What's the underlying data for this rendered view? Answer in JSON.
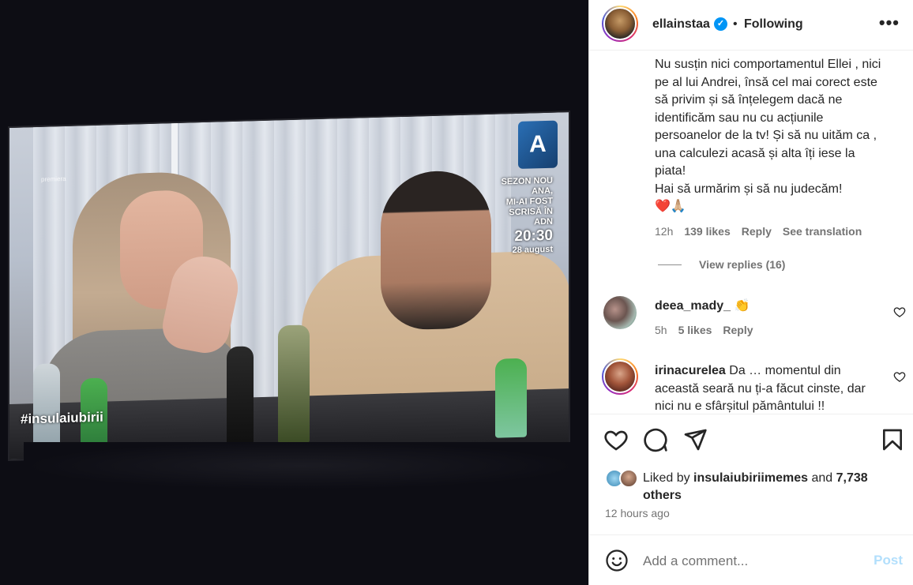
{
  "media": {
    "tv_logo": "A",
    "promo": [
      "SEZON NOU",
      "ANA,",
      "MI-AI FOST",
      "SCRISĂ ÎN ADN"
    ],
    "promo_time": "20:30",
    "promo_date": "28 august",
    "hashtag": "#insulaiubirii",
    "corner_label": "premiera"
  },
  "header": {
    "username": "ellainstaa",
    "verified_icon": "verified-badge-icon",
    "separator": "•",
    "follow_label": "Following",
    "more_label": "•••"
  },
  "comments": [
    {
      "text": "Nu susțin nici comportamentul Ellei , nici pe al lui Andrei, însă cel mai corect este să privim și să înțelegem dacă ne identificăm sau nu cu acțiunile persoanelor de la tv! Și să nu uităm ca , una calculezi acasă și alta îți iese la piata!",
      "text2": "Hai să urmărim și să nu judecăm!",
      "emoji": "❤️🙏🏼",
      "time": "12h",
      "likes": "139 likes",
      "reply": "Reply",
      "translate": "See translation",
      "view_replies": "View replies (16)"
    },
    {
      "user": "deea_mady_",
      "text": "👏",
      "time": "5h",
      "likes": "5 likes",
      "reply": "Reply"
    },
    {
      "user": "irinacurelea",
      "text": "Da … momentul din această seară nu ți-a făcut cinste, dar nici nu e sfârșitul pământului !!"
    }
  ],
  "actions": {
    "icons": [
      "heart-icon",
      "comment-icon",
      "share-icon",
      "bookmark-icon"
    ]
  },
  "likes": {
    "prefix": "Liked by",
    "user": "insulaiubiriimemes",
    "and": "and",
    "count": "7,738",
    "others": "others"
  },
  "time_ago": "12 hours ago",
  "add_comment": {
    "placeholder": "Add a comment...",
    "post_label": "Post"
  },
  "colors": {
    "accent": "#0095f6",
    "post_disabled": "#b2dffc",
    "muted": "#737373",
    "text": "#262626"
  }
}
